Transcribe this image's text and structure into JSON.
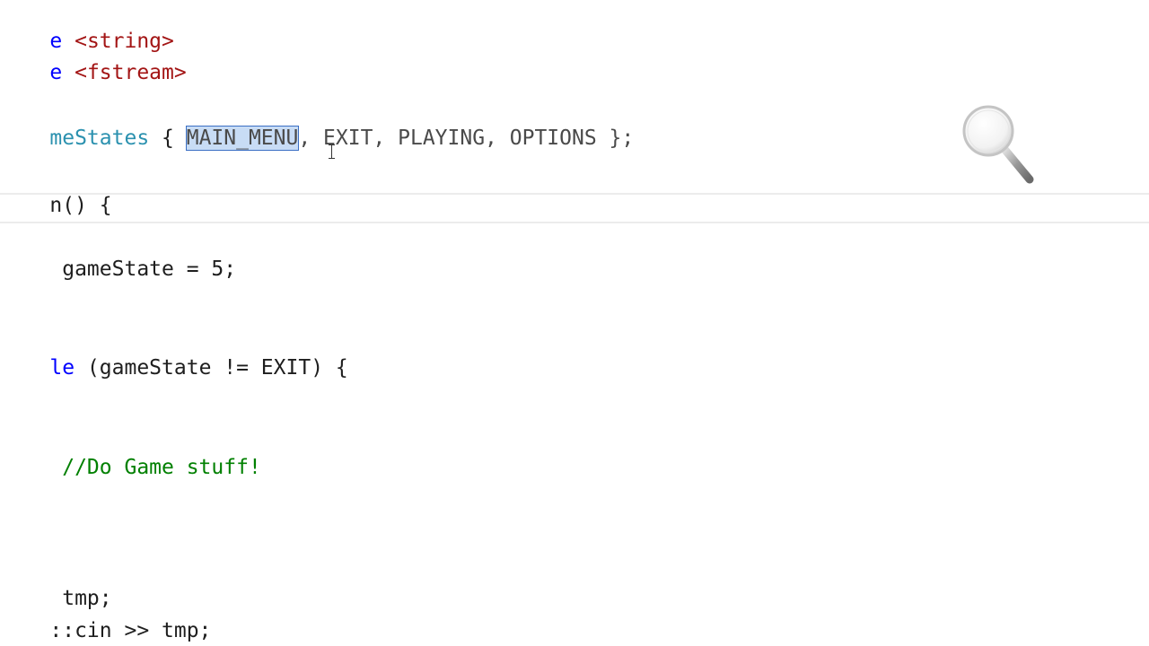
{
  "code_lines": {
    "l1": {
      "kw": "e",
      "rest": " <string>"
    },
    "l2": {
      "kw": "e",
      "rest": " <fstream>"
    },
    "l3": {
      "name": "meStates",
      "open": " { ",
      "selected": "MAIN_MENU",
      "rest": ", EXIT, PLAYING, OPTIONS };",
      "close": " };"
    },
    "l4": {
      "text": "n() {"
    },
    "l5": {
      "text": " gameState = 5;"
    },
    "l6": {
      "kw": "le",
      "rest": " (gameState != EXIT) {"
    },
    "l7": {
      "comment": " //Do Game stuff!"
    },
    "l8": {
      "text": " tmp;"
    },
    "l9": {
      "text": "::cin >> tmp;"
    }
  },
  "enum_values": [
    "MAIN_MENU",
    "EXIT",
    "PLAYING",
    "OPTIONS"
  ],
  "colors": {
    "keyword": "#0000ff",
    "string": "#a31515",
    "type": "#2b91af",
    "comment": "#008000",
    "selection": "#c8dcf5"
  },
  "icons": {
    "cursor": "ibeam-cursor-icon",
    "zoom": "magnifier-icon"
  }
}
